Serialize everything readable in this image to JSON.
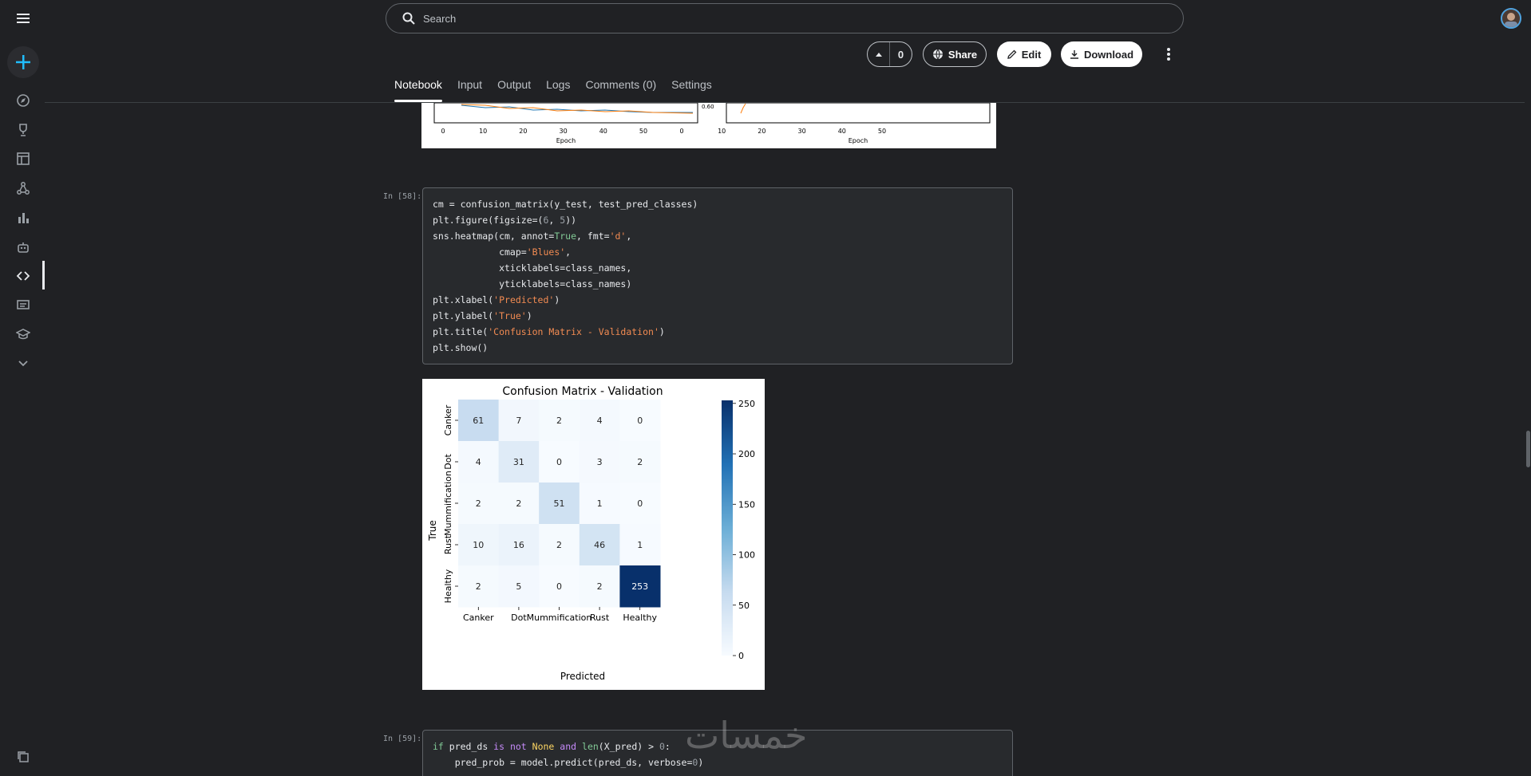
{
  "search": {
    "placeholder": "Search"
  },
  "toolbar": {
    "vote_count": "0",
    "share_label": "Share",
    "edit_label": "Edit",
    "download_label": "Download"
  },
  "tabs": [
    {
      "label": "Notebook",
      "active": true
    },
    {
      "label": "Input"
    },
    {
      "label": "Output"
    },
    {
      "label": "Logs"
    },
    {
      "label": "Comments (0)"
    },
    {
      "label": "Settings"
    }
  ],
  "sidebar": {
    "icons": [
      "menu-icon",
      "create-icon",
      "compass-icon",
      "trophy-icon",
      "table-icon",
      "models-icon",
      "chart-icon",
      "robot-icon",
      "code-icon",
      "discussion-icon",
      "school-icon",
      "chevron-down-icon",
      "copy-icon"
    ]
  },
  "prev_chart": {
    "ticks": [
      "0",
      "10",
      "20",
      "30",
      "40",
      "50"
    ],
    "xlabel": "Epoch",
    "ytick": "0.60"
  },
  "cells": [
    {
      "prompt": "In [58]:"
    },
    {
      "prompt": "In [59]:"
    }
  ],
  "chart_data": {
    "type": "heatmap",
    "title": "Confusion Matrix - Validation",
    "xlabel": "Predicted",
    "ylabel": "True",
    "categories": [
      "Canker",
      "Dot",
      "Mummification",
      "Rust",
      "Healthy"
    ],
    "matrix": [
      [
        61,
        7,
        2,
        4,
        0
      ],
      [
        4,
        31,
        0,
        3,
        2
      ],
      [
        2,
        2,
        51,
        1,
        0
      ],
      [
        10,
        16,
        2,
        46,
        1
      ],
      [
        2,
        5,
        0,
        2,
        253
      ]
    ],
    "colorbar_ticks": [
      "0",
      "50",
      "100",
      "150",
      "200",
      "250"
    ],
    "vmin": 0,
    "vmax": 253,
    "cmap": "Blues"
  },
  "watermark": "خمسات"
}
